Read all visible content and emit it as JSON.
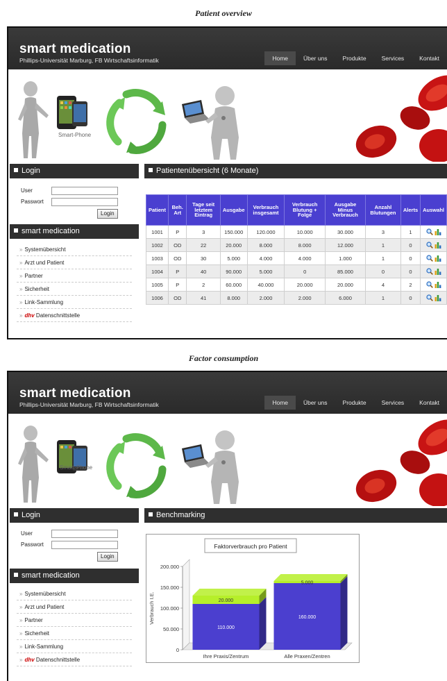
{
  "captions": {
    "patient_overview": "Patient overview",
    "factor_consumption": "Factor consumption"
  },
  "header": {
    "title": "smart medication",
    "subtitle": "Phillips-Universität Marburg, FB Wirtschaftsinformatik",
    "nav": [
      "Home",
      "Über uns",
      "Produkte",
      "Services",
      "Kontakt"
    ],
    "active_nav": "Home"
  },
  "banner": {
    "phone_label": "Smart-Phone",
    "phone_label_2": "Smart-Phone"
  },
  "login": {
    "title": "Login",
    "user_label": "User",
    "password_label": "Passwort",
    "user_value": "",
    "password_value": "",
    "button": "Login"
  },
  "menu": {
    "title": "smart medication",
    "items": [
      "Systemübersicht",
      "Arzt und Patient",
      "Partner",
      "Sicherheit",
      "Link-Sammlung"
    ],
    "dhv_logo": "dhv",
    "last_item": "Datenschnittstelle"
  },
  "patients": {
    "title": "Patientenübersicht (6 Monate)",
    "columns": [
      "Patient",
      "Beh. Art",
      "Tage seit letztem Eintrag",
      "Ausgabe",
      "Verbrauch insgesamt",
      "Verbrauch Blutung + Folge",
      "Ausgabe Minus Verbrauch",
      "Anzahl Blutungen",
      "Alerts",
      "Auswahl"
    ],
    "rows": [
      [
        "1001",
        "P",
        "3",
        "150.000",
        "120.000",
        "10.000",
        "30.000",
        "3",
        "1"
      ],
      [
        "1002",
        "OD",
        "22",
        "20.000",
        "8.000",
        "8.000",
        "12.000",
        "1",
        "0"
      ],
      [
        "1003",
        "OD",
        "30",
        "5.000",
        "4.000",
        "4.000",
        "1.000",
        "1",
        "0"
      ],
      [
        "1004",
        "P",
        "40",
        "90.000",
        "5.000",
        "0",
        "85.000",
        "0",
        "0"
      ],
      [
        "1005",
        "P",
        "2",
        "60.000",
        "40.000",
        "20.000",
        "20.000",
        "4",
        "2"
      ],
      [
        "1006",
        "OD",
        "41",
        "8.000",
        "2.000",
        "2.000",
        "6.000",
        "1",
        "0"
      ]
    ],
    "icons": [
      "magnifier-icon",
      "bar-chart-icon"
    ]
  },
  "benchmark": {
    "title": "Benchmarking"
  },
  "chart_data": {
    "type": "bar",
    "title": "Faktorverbrauch pro Patient",
    "ylabel": "Verbrauch I.E.",
    "xlabel": "",
    "categories": [
      "Ihre Praxis/Zentrum",
      "Alle Praxen/Zentren"
    ],
    "series": [
      {
        "values": [
          110000,
          160000
        ],
        "labels": [
          "110.000",
          "160.000"
        ],
        "color": "#4b3fcf"
      },
      {
        "values": [
          20000,
          5000
        ],
        "labels": [
          "20.000",
          "5.000"
        ],
        "color": "#b6ef2a"
      }
    ],
    "ylim": [
      0,
      200000
    ],
    "yticks": [
      "0",
      "50.000",
      "100.000",
      "150.000",
      "200.000"
    ],
    "stacked": true,
    "grid": false
  },
  "colors": {
    "header_bg": "#2f2f2f",
    "table_header": "#4a3fd0",
    "panel_header": "#2f2f2f"
  }
}
